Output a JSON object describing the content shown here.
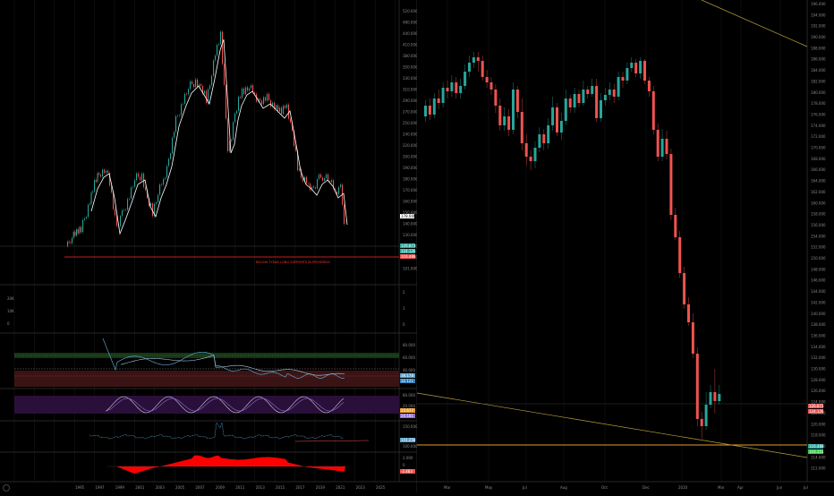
{
  "colors": {
    "bg": "#000000",
    "up": "#26a69a",
    "down": "#ef5350",
    "grid": "#2a2a2a",
    "ma": "#ffffff",
    "trend": "#b8a23a",
    "support": "#e89a2c",
    "red_line": "#ff2b2b"
  },
  "left_chart": {
    "price_ticks": [
      "520.000",
      "480.000",
      "440.000",
      "410.000",
      "380.000",
      "350.000",
      "330.000",
      "310.000",
      "290.000",
      "270.000",
      "250.000",
      "240.000",
      "220.000",
      "200.000",
      "190.000",
      "180.000",
      "170.000",
      "160.000",
      "150.000",
      "140.000",
      "130.000",
      "120.000",
      "110.000",
      "101.000"
    ],
    "current_price_label": "178.000",
    "badges": [
      {
        "text": "126.873",
        "color": "#26a69a"
      },
      {
        "text": "124.126",
        "color": "#26a69a"
      },
      {
        "text": "116.488",
        "color": "#ef5350"
      }
    ],
    "annotation": "BELOW 7YEAR LONG SUPPORTS IN PROGRESS",
    "x_ticks": [
      "1995",
      "1997",
      "1999",
      "2001",
      "2003",
      "2005",
      "2007",
      "2009",
      "2011",
      "2013",
      "2015",
      "2017",
      "2019",
      "2021",
      "2023",
      "2025"
    ],
    "volume_ticks": [
      "20K",
      "10K",
      "0"
    ],
    "volume_right_ticks": [
      "2",
      "1",
      "0"
    ],
    "rsi_ticks": [
      "80.000",
      "60.000",
      "40.000"
    ],
    "rsi_badges": [
      {
        "text": "38.178",
        "color": "#5aa0c8"
      },
      {
        "text": "32.121",
        "color": "#2e7fb8"
      }
    ],
    "stoch_ticks": [
      "80.000",
      "20.000"
    ],
    "stoch_badges": [
      {
        "text": "23.677",
        "color": "#e89a2c"
      },
      {
        "text": "24.181",
        "color": "#8a6fd0"
      }
    ],
    "osc_ticks": [
      "150.000",
      "100.000"
    ],
    "osc_badges": [
      {
        "text": "141.258",
        "color": "#5aa0c8"
      }
    ],
    "macd_ticks": [
      "2.000",
      "0",
      "-2.000"
    ],
    "macd_badges": [
      {
        "text": "-2.483",
        "color": "#ef5350"
      }
    ]
  },
  "right_chart": {
    "price_ticks": [
      "196.000",
      "194.000",
      "192.000",
      "190.000",
      "188.000",
      "186.000",
      "184.000",
      "182.000",
      "180.000",
      "178.000",
      "176.000",
      "174.000",
      "172.000",
      "170.000",
      "168.000",
      "166.000",
      "164.000",
      "162.000",
      "160.000",
      "158.000",
      "156.000",
      "154.000",
      "152.000",
      "150.000",
      "148.000",
      "146.000",
      "144.000",
      "142.000",
      "140.000",
      "138.000",
      "136.000",
      "134.000",
      "132.000",
      "130.000",
      "128.000",
      "126.000",
      "124.000",
      "122.000",
      "120.000",
      "118.000",
      "116.000",
      "114.000",
      "112.000"
    ],
    "badges": [
      {
        "text": "126.873",
        "color": "#ef5350"
      },
      {
        "text": "124.126",
        "color": "#ef5350"
      },
      {
        "text": "116.488",
        "color": "#26a69a"
      },
      {
        "text": "116.151",
        "color": "#2ecc40"
      }
    ],
    "x_ticks": [
      "Mar",
      "May",
      "Jul",
      "Aug",
      "Oct",
      "Dec",
      "2020",
      "Mar",
      "Apr",
      "Jun",
      "Jul"
    ]
  }
}
